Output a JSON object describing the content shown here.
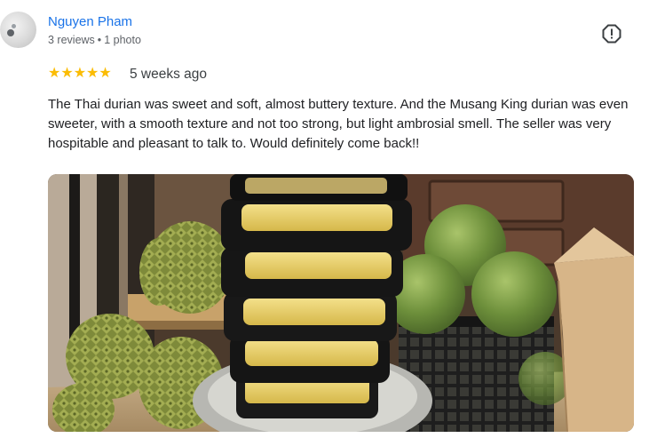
{
  "reviewer": {
    "name": "Nguyen Pham",
    "reviews": "3 reviews",
    "separator": "•",
    "photos": "1 photo"
  },
  "rating": {
    "stars": "★★★★★",
    "value": 5,
    "time_ago": "5 weeks ago",
    "star_color": "#fbbc04"
  },
  "review_text": "The Thai durian was sweet and soft, almost buttery texture. And the Musang King durian was even sweeter, with a smooth texture and not too strong, but light ambrosial smell. The seller was very hospitable and pleasant to talk to. Would definitely come back!!",
  "icons": {
    "report": "report-icon",
    "avatar": "avatar"
  },
  "colors": {
    "name_link": "#1a73e8",
    "meta_text": "#5f6368"
  }
}
